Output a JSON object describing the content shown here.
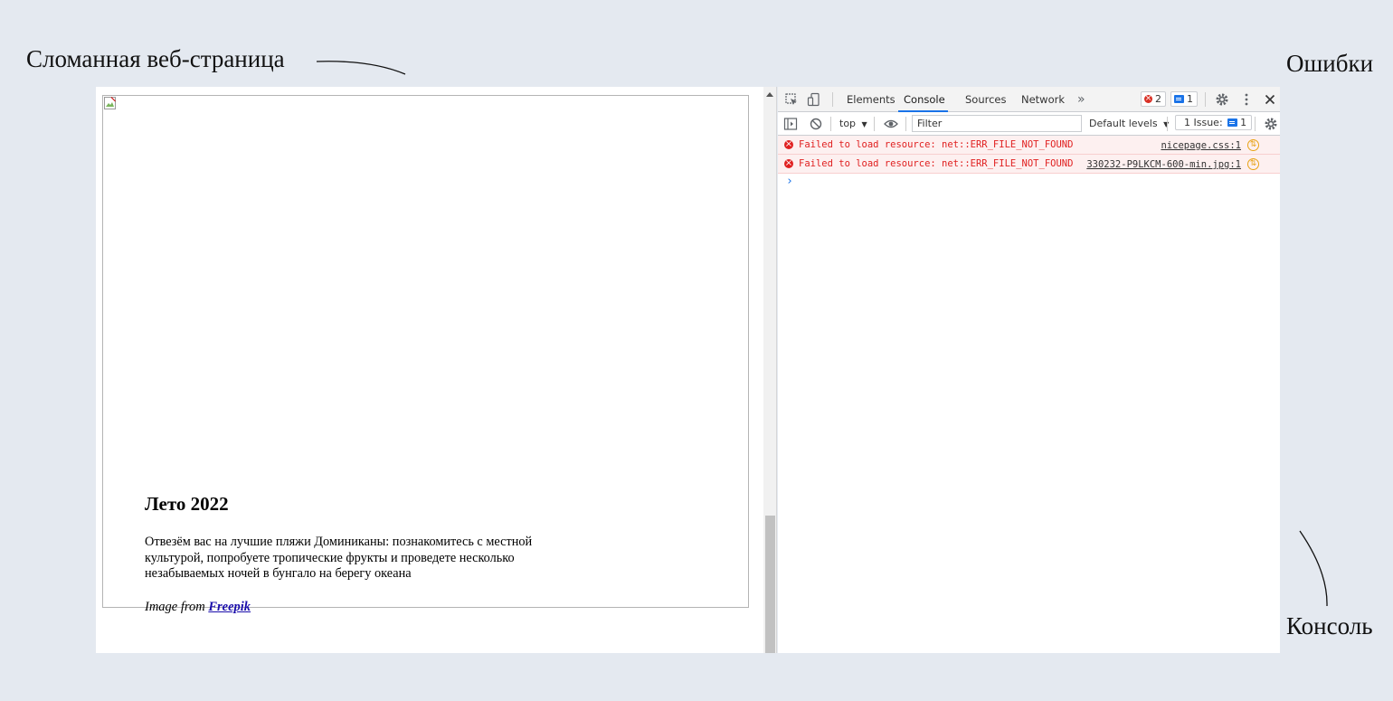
{
  "annotations": {
    "broken_page": "Сломанная веб-страница",
    "errors": "Ошибки",
    "console": "Консоль"
  },
  "webpage": {
    "title": "Лето 2022",
    "text": "Отвезём вас на лучшие пляжи Доминиканы: познакомитесь с местной культурой, попробуете тропические фрукты и проведете несколько незабываемых ночей в бунгало на берегу океана",
    "credit_prefix": "Image from",
    "credit_link": "Freepik"
  },
  "devtools": {
    "tabs": [
      "Elements",
      "Console",
      "Sources",
      "Network"
    ],
    "active_tab": "Console",
    "more_tabs": "»",
    "error_count": "2",
    "message_count": "1",
    "context": "top",
    "filter_placeholder": "Filter",
    "levels": "Default levels",
    "issues_label": "1 Issue:",
    "issues_count": "1",
    "messages": [
      {
        "type": "error",
        "text": "Failed to load resource: net::ERR_FILE_NOT_FOUND",
        "source": "nicepage.css:1"
      },
      {
        "type": "error",
        "text": "Failed to load resource: net::ERR_FILE_NOT_FOUND",
        "source": "330232-P9LKCM-600-min.jpg:1"
      }
    ],
    "prompt": "›"
  },
  "colors": {
    "background": "#e4e9f0",
    "error_text": "#e02020",
    "error_row_bg": "#fdf0f0",
    "accent": "#1a73e8"
  }
}
